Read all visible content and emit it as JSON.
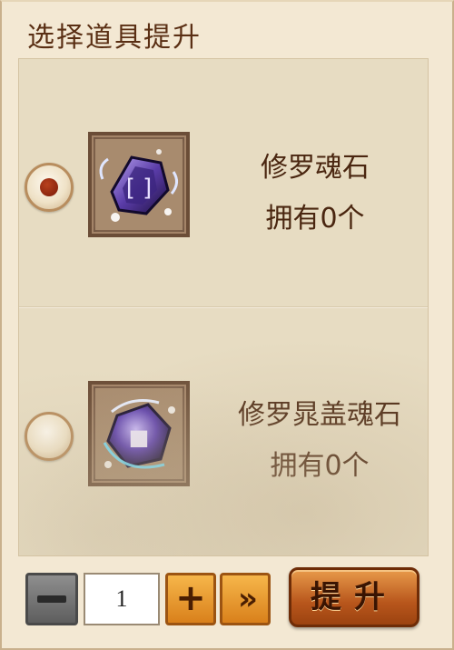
{
  "panel": {
    "title": "选择道具提升"
  },
  "items": [
    {
      "name": "修罗魂石",
      "count_text": "拥有0个",
      "selected": true,
      "icon": "purple-rune-stone-icon"
    },
    {
      "name": "修罗晁盖魂石",
      "count_text": "拥有0个",
      "selected": false,
      "icon": "purple-glyph-stone-icon"
    }
  ],
  "controls": {
    "quantity": "1",
    "minus_icon": "minus-icon",
    "plus_label": "+",
    "max_label": "»",
    "upgrade_label": "提升"
  },
  "colors": {
    "panel_bg": "#f3e8d3",
    "text": "#4a2610",
    "button_orange": "#d9801b",
    "button_gray": "#5e5e5e"
  }
}
